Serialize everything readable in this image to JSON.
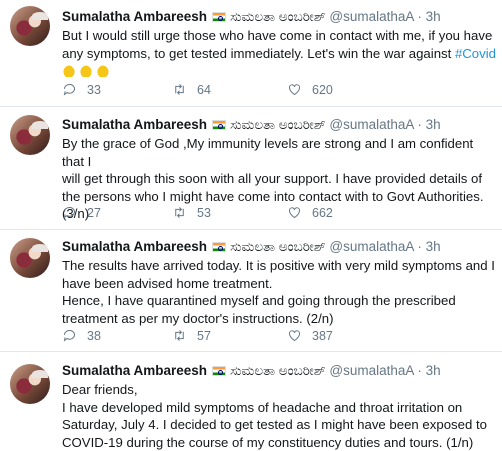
{
  "author": {
    "name": "Sumalatha Ambareesh",
    "name_kannada": "ಸುಮಲತಾ ಅಂಬರೀಶ್",
    "handle": "@sumalathaA"
  },
  "separator": "·",
  "tweets": [
    {
      "time": "3h",
      "text_lines": [
        "But I would still urge those who have come in contact with me, if you have",
        "any symptoms, to get tested immediately. Let's win the war against "
      ],
      "hashtag": "#Covid",
      "emoji": "🙏🙏🙏",
      "replies": "33",
      "retweets": "64",
      "likes": "620"
    },
    {
      "time": "3h",
      "text_lines": [
        "By the grace of God ,My immunity levels are strong and I am confident that I",
        "will get through this soon with all your support. I have provided details of",
        "the persons who I might have come into contact with to Govt Authorities.",
        "(3/n)"
      ],
      "replies": "27",
      "retweets": "53",
      "likes": "662"
    },
    {
      "time": "3h",
      "text_lines": [
        "The results have arrived today. It is positive with very mild symptoms and I",
        "have been advised home treatment.",
        "Hence, I have quarantined myself and going through the prescribed",
        "treatment as per my doctor's instructions. (2/n)"
      ],
      "replies": "38",
      "retweets": "57",
      "likes": "387"
    },
    {
      "time": "3h",
      "text_lines": [
        "Dear friends,",
        "I have developed mild symptoms of headache and throat irritation on",
        "Saturday, July 4. I decided to get tested as I might have been exposed to",
        "COVID-19 during the course of my constituency duties and tours. (1/n)"
      ]
    }
  ],
  "icons": {
    "reply": "reply-icon",
    "retweet": "retweet-icon",
    "like": "heart-icon",
    "flag": "india-flag-icon"
  }
}
